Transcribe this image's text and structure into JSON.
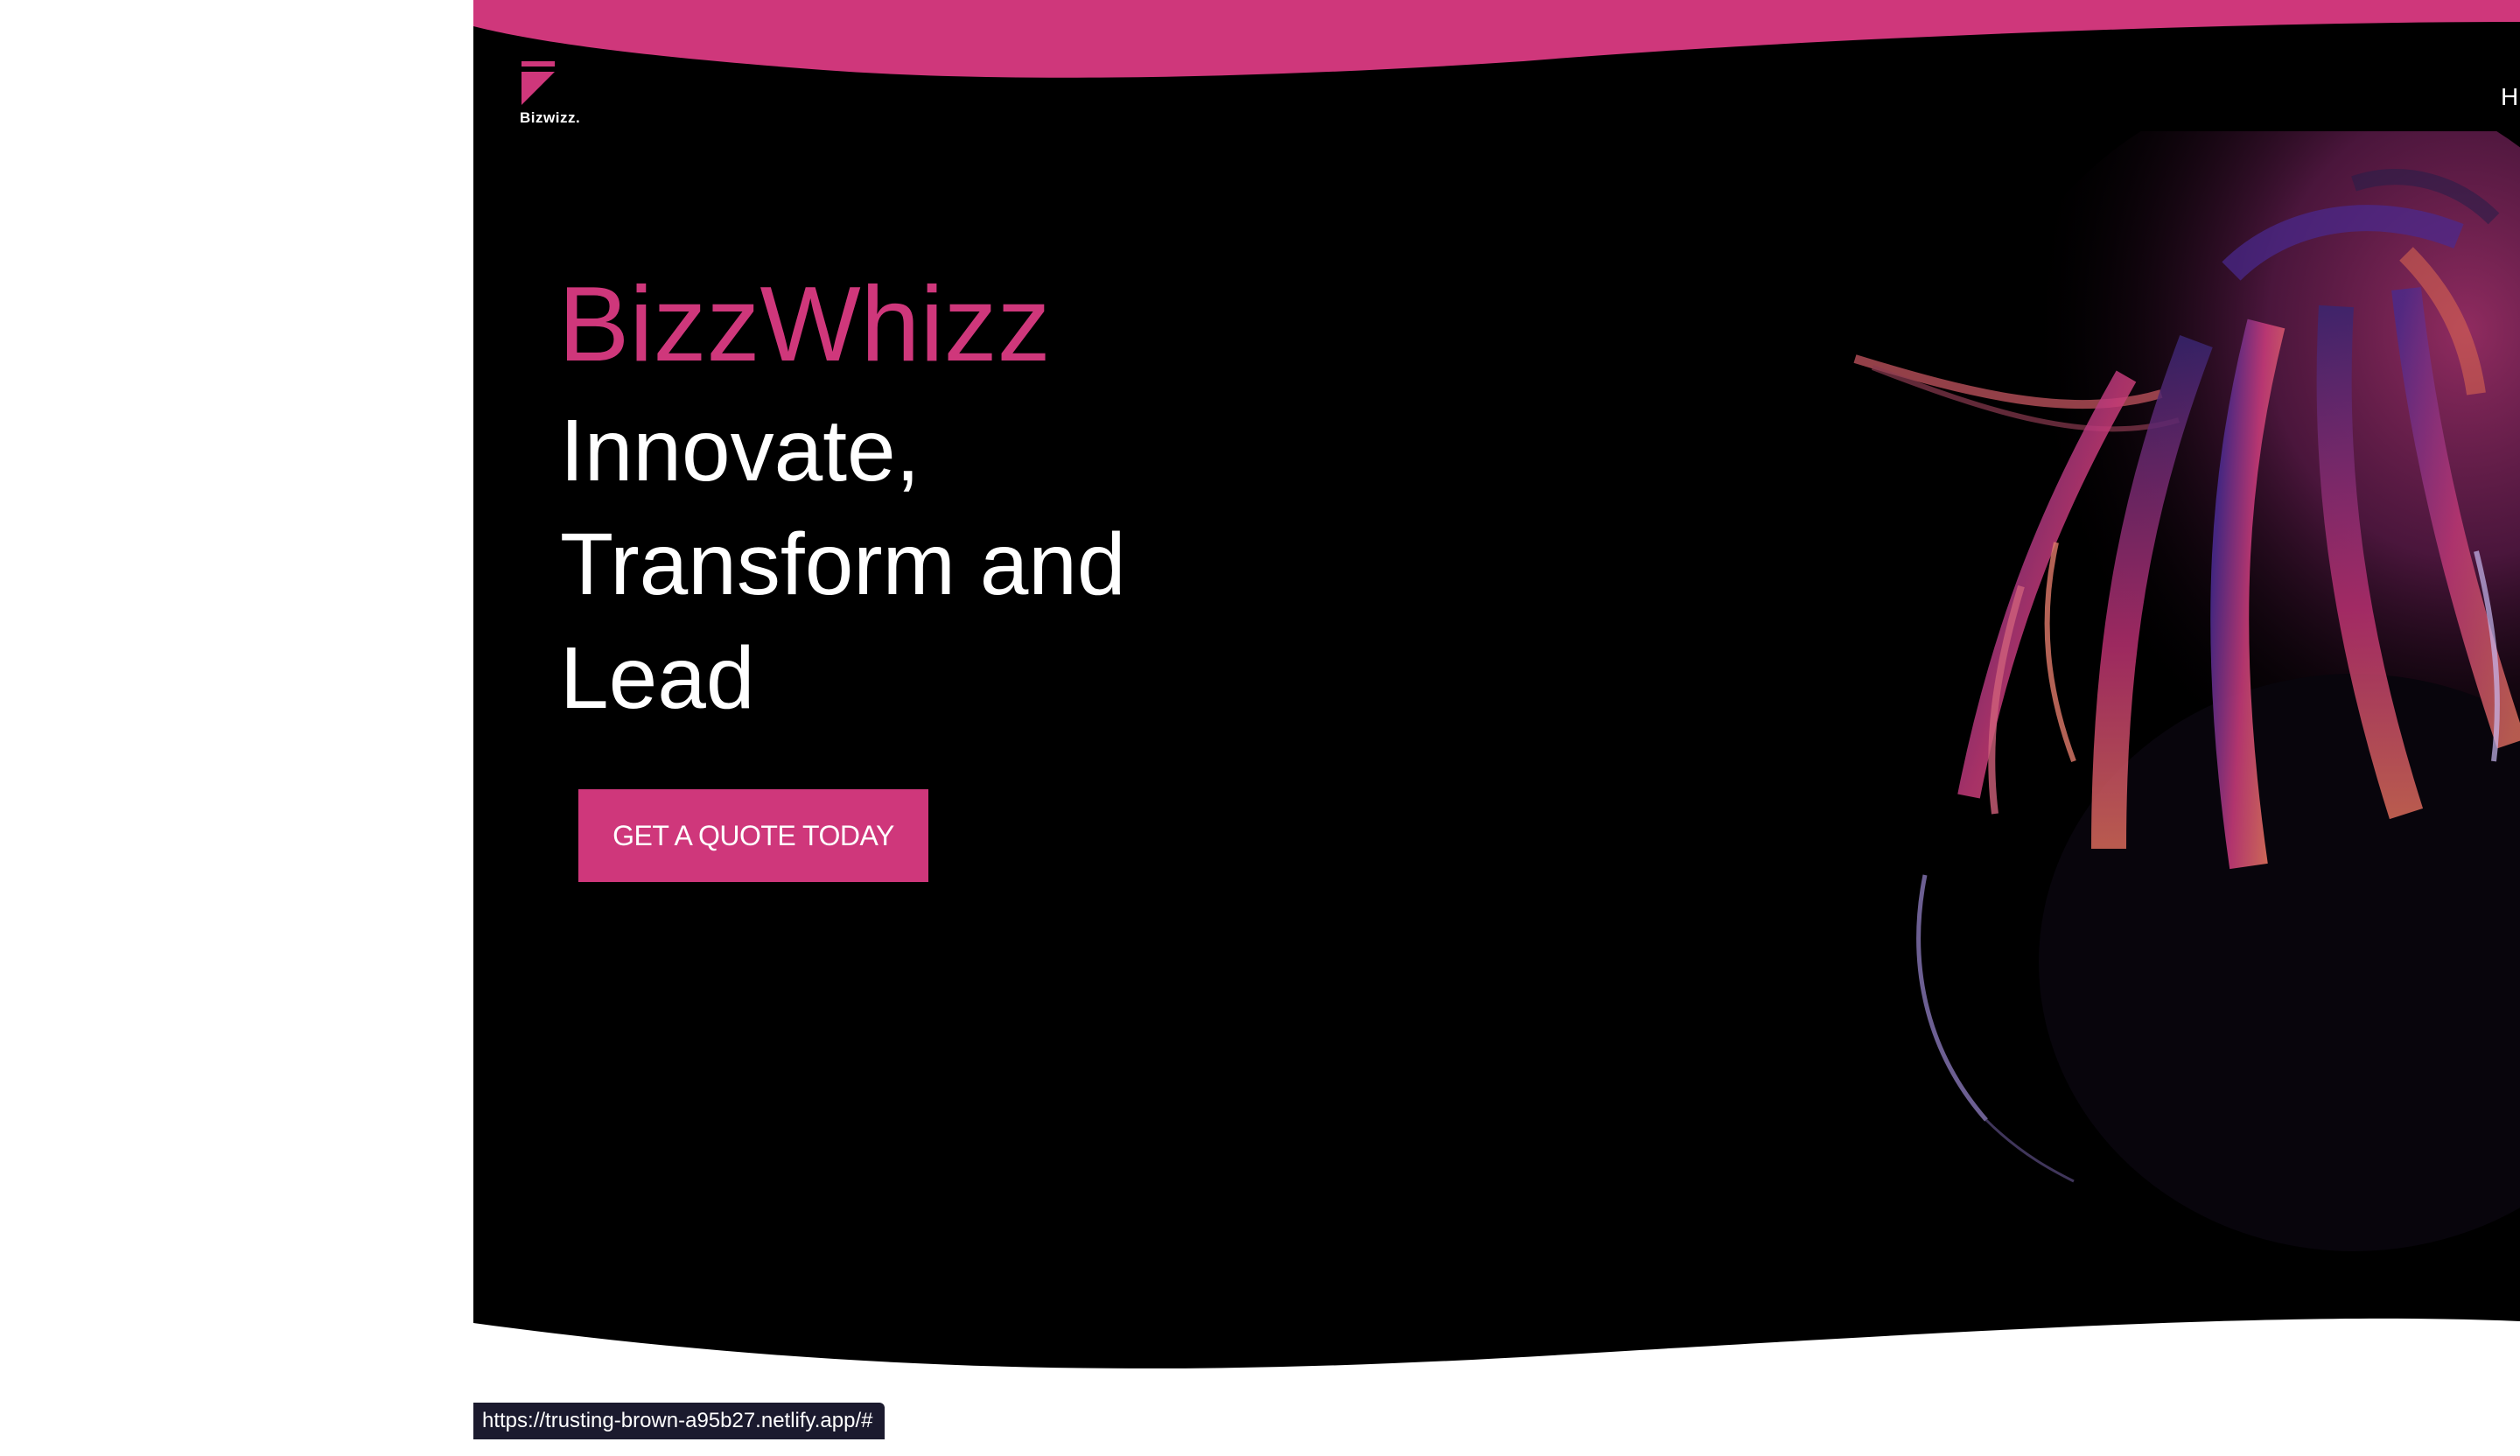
{
  "brand": {
    "logo_text": "Bizwizz.",
    "title": "BizzWhizz",
    "tagline": "Innovate, Transform and Lead"
  },
  "nav": {
    "partial_item": "H"
  },
  "hero": {
    "cta_label": "GET A QUOTE TODAY",
    "image": "hair-photo"
  },
  "status_bar": {
    "url": "https://trusting-brown-a95b27.netlify.app/#"
  },
  "colors": {
    "accent": "#cf377b",
    "background": "#000000",
    "text": "#ffffff",
    "page": "#ffffff"
  }
}
